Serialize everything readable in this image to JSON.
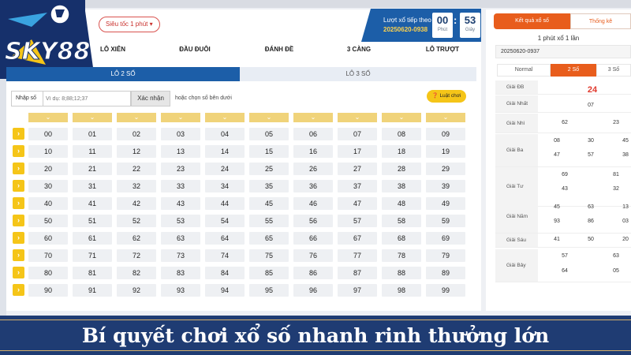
{
  "logo": {
    "text": "SKY88"
  },
  "header": {
    "speed_button": "Siêu tốc 1 phút",
    "countdown_label": "Lượt xổ tiếp theo",
    "next_draw_id": "20250620-0938",
    "minutes": "00",
    "minutes_unit": "Phút",
    "seconds": "53",
    "seconds_unit": "Giây"
  },
  "categories": [
    "LÔ XIÊN",
    "ĐẦU ĐUÔI",
    "ĐÁNH ĐỀ",
    "3 CÀNG",
    "LÔ TRƯỢT"
  ],
  "subtabs": {
    "active": "LÔ 2 SỐ",
    "inactive": "LÔ 3 SỐ"
  },
  "input": {
    "label": "Nhập số",
    "placeholder": "Ví dụ: 8;88;12;37",
    "confirm": "Xác nhận",
    "hint": "hoặc chọn số bên dưới",
    "rules": "Luật chơi"
  },
  "grid": {
    "columns": [
      "00",
      "01",
      "02",
      "03",
      "04",
      "05",
      "06",
      "07",
      "08",
      "09"
    ],
    "rows": [
      [
        "00",
        "01",
        "02",
        "03",
        "04",
        "05",
        "06",
        "07",
        "08",
        "09"
      ],
      [
        "10",
        "11",
        "12",
        "13",
        "14",
        "15",
        "16",
        "17",
        "18",
        "19"
      ],
      [
        "20",
        "21",
        "22",
        "23",
        "24",
        "25",
        "26",
        "27",
        "28",
        "29"
      ],
      [
        "30",
        "31",
        "32",
        "33",
        "34",
        "35",
        "36",
        "37",
        "38",
        "39"
      ],
      [
        "40",
        "41",
        "42",
        "43",
        "44",
        "45",
        "46",
        "47",
        "48",
        "49"
      ],
      [
        "50",
        "51",
        "52",
        "53",
        "54",
        "55",
        "56",
        "57",
        "58",
        "59"
      ],
      [
        "60",
        "61",
        "62",
        "63",
        "64",
        "65",
        "66",
        "67",
        "68",
        "69"
      ],
      [
        "70",
        "71",
        "72",
        "73",
        "74",
        "75",
        "76",
        "77",
        "78",
        "79"
      ],
      [
        "80",
        "81",
        "82",
        "83",
        "84",
        "85",
        "86",
        "87",
        "88",
        "89"
      ],
      [
        "90",
        "91",
        "92",
        "93",
        "94",
        "95",
        "96",
        "97",
        "98",
        "99"
      ]
    ]
  },
  "results": {
    "tab_active": "Kết quả xổ số",
    "tab_inactive": "Thống kê",
    "title": "1 phút xổ 1 lần",
    "draw_id": "20250620-0937",
    "modes": [
      "Normal",
      "2 Số",
      "3 Số"
    ],
    "prizes": [
      {
        "name": "Giải ĐB",
        "values": [
          "24"
        ]
      },
      {
        "name": "Giải Nhất",
        "values": [
          "07"
        ]
      },
      {
        "name": "Giải Nhì",
        "values": [
          "62",
          "23"
        ]
      },
      {
        "name": "Giải Ba",
        "values": [
          "08",
          "30",
          "45",
          "47",
          "57",
          "38"
        ]
      },
      {
        "name": "Giải Tư",
        "values": [
          "69",
          "81",
          "43",
          "32"
        ]
      },
      {
        "name": "Giải Năm",
        "values": [
          "45",
          "63",
          "13",
          "93",
          "86",
          "03"
        ]
      },
      {
        "name": "Giải Sáu",
        "values": [
          "41",
          "50",
          "20"
        ]
      },
      {
        "name": "Giải Bảy",
        "values": [
          "57",
          "63",
          "64",
          "05"
        ]
      }
    ]
  },
  "banner": {
    "text": "Bí quyết chơi xổ số nhanh rinh thưởng lớn"
  },
  "colors": {
    "primary": "#1c5ea8",
    "accent": "#e85d1c",
    "yellow": "#f5c518",
    "banner": "#1f3c73"
  }
}
